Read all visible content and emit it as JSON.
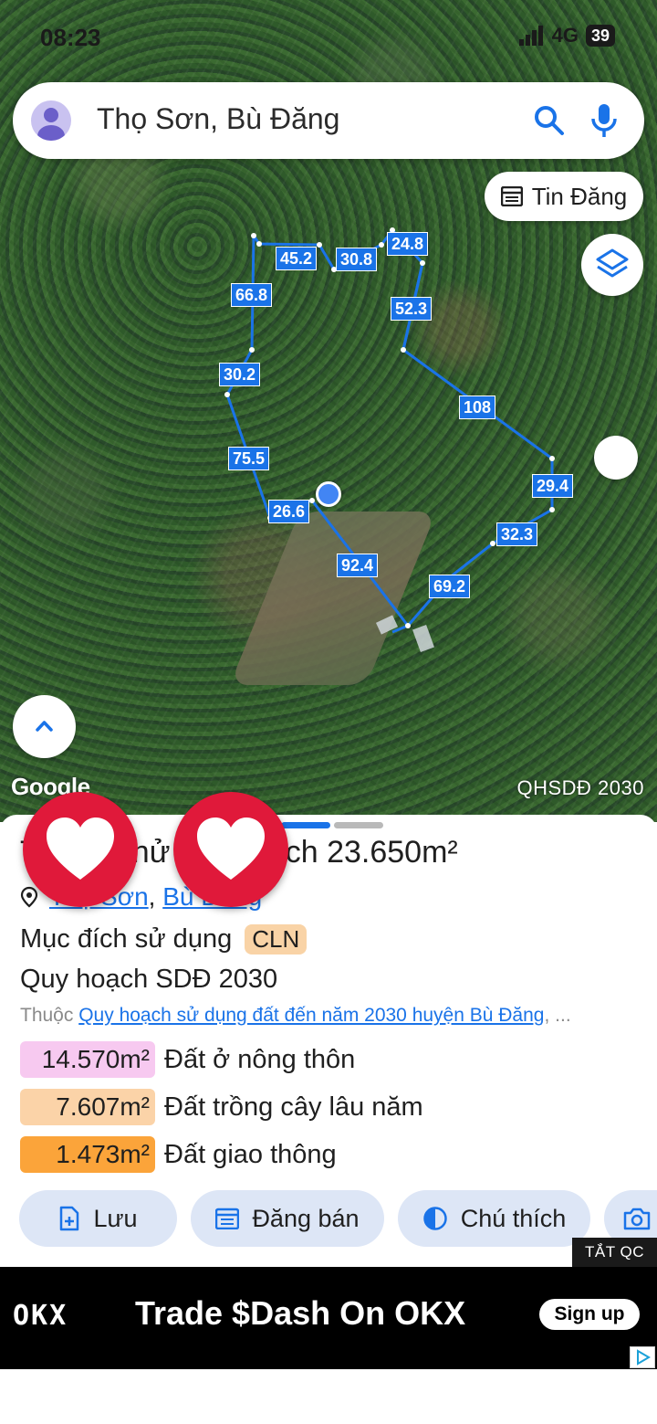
{
  "status_bar": {
    "time": "08:23",
    "network": "4G",
    "battery": "39"
  },
  "search": {
    "value": "Thọ Sơn, Bù Đăng"
  },
  "map": {
    "tin_dang_label": "Tin Đăng",
    "google_logo": "Google",
    "layer_badge": "QHSDĐ 2030",
    "segment_labels": [
      "45.2",
      "30.8",
      "24.8",
      "66.8",
      "52.3",
      "30.2",
      "108",
      "75.5",
      "29.4",
      "26.6",
      "32.3",
      "92.4",
      "69.2"
    ]
  },
  "sheet": {
    "title_prefix": "T",
    "title_mid": "hử",
    "title_area": "Diện tích 23.650m²",
    "location": {
      "commune": "Thọ Sơn",
      "district": "Bù Đăng",
      "separator": ","
    },
    "purpose_label": "Mục đích sử dụng",
    "purpose_code": "CLN",
    "plan_label": "Quy hoạch SDĐ 2030",
    "belong_prefix": "Thuộc",
    "belong_link": "Quy hoạch sử dụng đất đến năm 2030 huyện Bù Đăng",
    "belong_suffix": ", ...",
    "land_uses": [
      {
        "area": "14.570m²",
        "label": "Đất ở nông thôn",
        "color": "#f7c9f0"
      },
      {
        "area": "7.607m²",
        "label": "Đất trồng cây lâu năm",
        "color": "#fbd3a8"
      },
      {
        "area": "1.473m²",
        "label": "Đất giao thông",
        "color": "#fba43a"
      }
    ],
    "actions": {
      "save": "Lưu",
      "post_sale": "Đăng bán",
      "legend": "Chú thích"
    }
  },
  "ad": {
    "close_label": "TẮT QC",
    "brand": "OKX",
    "headline": "Trade $Dash On OKX",
    "cta": "Sign up"
  },
  "colors": {
    "accent": "#1a73e8",
    "heart": "#e0193a",
    "chip_bg": "#dde6f6"
  }
}
